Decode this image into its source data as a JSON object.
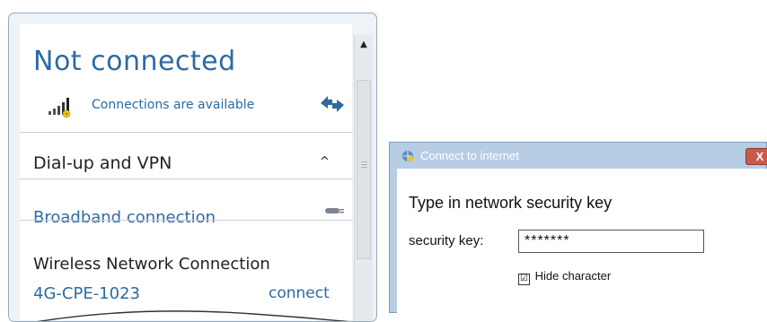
{
  "flyout": {
    "status_title": "Not connected",
    "connections_available": "Connections are available",
    "refresh_icon": "refresh-icon",
    "dialup_section": "Dial-up and VPN",
    "dialup_chevron": "^",
    "broadband_label": "Broadband connection",
    "wireless_section": "Wireless Network Connection",
    "ssid": "4G-CPE-1023",
    "connect_label": "connect"
  },
  "scrollbar": {
    "up_arrow": "▲"
  },
  "dialog": {
    "title": "Connect to internet",
    "close_label": "X",
    "heading": "Type in network security key",
    "key_label": "security key:",
    "key_value": "*******",
    "hide_checkbox": "☑",
    "hide_label": "Hide character"
  },
  "colors": {
    "accent": "#2d6aa2",
    "dialog_frame": "#b6cde4",
    "close_red": "#c85a4c"
  }
}
